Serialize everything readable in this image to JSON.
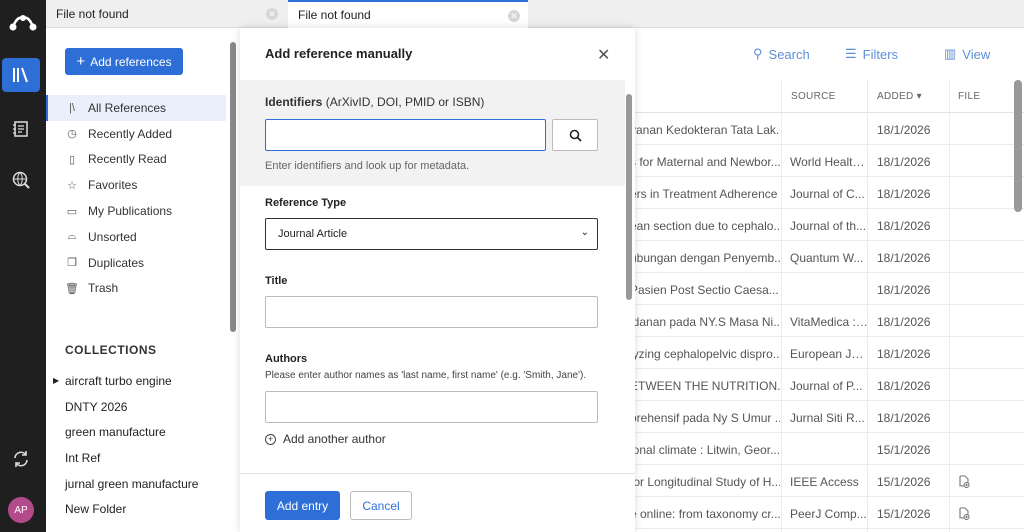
{
  "tabs": [
    {
      "label": "File not found"
    },
    {
      "label": "File not found"
    }
  ],
  "sidebar": {
    "add_button": "Add references",
    "items": [
      {
        "label": "All References",
        "icon": "library-icon"
      },
      {
        "label": "Recently Added",
        "icon": "clock-icon"
      },
      {
        "label": "Recently Read",
        "icon": "bookmark-icon"
      },
      {
        "label": "Favorites",
        "icon": "star-icon"
      },
      {
        "label": "My Publications",
        "icon": "document-icon"
      },
      {
        "label": "Unsorted",
        "icon": "inbox-icon"
      },
      {
        "label": "Duplicates",
        "icon": "duplicate-icon"
      },
      {
        "label": "Trash",
        "icon": "trash-icon"
      }
    ],
    "collections_heading": "COLLECTIONS",
    "collections": [
      "aircraft turbo engine",
      "DNTY 2026",
      "green manufacture",
      "Int Ref",
      "jurnal green manufacture",
      "New Folder"
    ]
  },
  "toolbar": {
    "search": "Search",
    "filters": "Filters",
    "view": "View"
  },
  "table": {
    "headers": {
      "source": "SOURCE",
      "added": "ADDED ▾",
      "file": "FILE"
    },
    "rows": [
      {
        "title": "yanan Kedokteran Tata Lak...",
        "source": "",
        "added": "18/1/2026",
        "file": ""
      },
      {
        "title": "s for Maternal and Newbor...",
        "source": "World Health...",
        "added": "18/1/2026",
        "file": ""
      },
      {
        "title": "ers in Treatment Adherence",
        "source": "Journal of C...",
        "added": "18/1/2026",
        "file": ""
      },
      {
        "title": "ean section due to cephalo...",
        "source": "Journal of th...",
        "added": "18/1/2026",
        "file": ""
      },
      {
        "title": "ubungan dengan Penyemb...",
        "source": "Quantum W...",
        "added": "18/1/2026",
        "file": ""
      },
      {
        "title": "Pasien Post Sectio Caesa...",
        "source": "",
        "added": "18/1/2026",
        "file": ""
      },
      {
        "title": "idanan pada NY.S Masa Ni...",
        "source": "VitaMedica : ...",
        "added": "18/1/2026",
        "file": ""
      },
      {
        "title": "lyzing cephalopelvic dispro...",
        "source": "European Jo...",
        "added": "18/1/2026",
        "file": ""
      },
      {
        "title": "ETWEEN THE NUTRITION...",
        "source": "Journal of P...",
        "added": "18/1/2026",
        "file": ""
      },
      {
        "title": "orehensif pada Ny S Umur ...",
        "source": "Jurnal Siti R...",
        "added": "18/1/2026",
        "file": ""
      },
      {
        "title": "ional climate : Litwin, Geor...",
        "source": "",
        "added": "15/1/2026",
        "file": ""
      },
      {
        "title": "for Longitudinal Study of H...",
        "source": "IEEE Access",
        "added": "15/1/2026",
        "file": "file-add-icon"
      },
      {
        "title": "e online: from taxonomy cr...",
        "source": "PeerJ Comp...",
        "added": "15/1/2026",
        "file": "file-add-icon"
      }
    ]
  },
  "modal": {
    "title": "Add reference manually",
    "identifiers_label": "Identifiers",
    "identifiers_sub": "(ArXivID, DOI, PMID or ISBN)",
    "identifiers_value": "",
    "identifiers_hint": "Enter identifiers and look up for metadata.",
    "reference_type_label": "Reference Type",
    "reference_type_value": "Journal Article",
    "title_label": "Title",
    "title_value": "",
    "authors_label": "Authors",
    "authors_hint": "Please enter author names as 'last name, first name' (e.g. 'Smith, Jane').",
    "authors_value": "",
    "add_author": "Add another author",
    "add_entry": "Add entry",
    "cancel": "Cancel"
  },
  "user": {
    "initials": "AP"
  },
  "colors": {
    "accent": "#2d6fd6",
    "rail": "#1f1f1f"
  }
}
